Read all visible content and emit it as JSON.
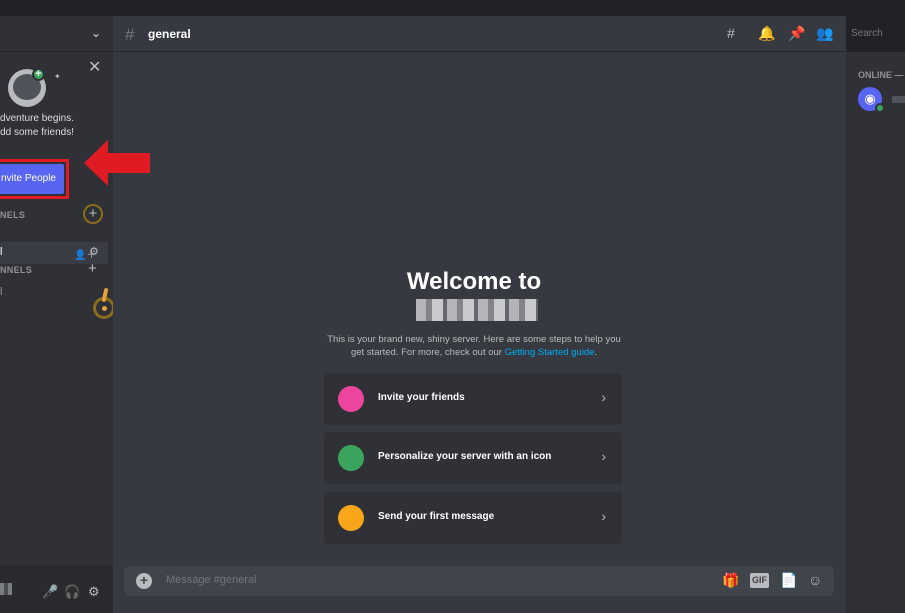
{
  "sidebar": {
    "popup": {
      "close": "✕",
      "line1": "dventure begins.",
      "line2": "dd some friends!",
      "invite_label": "nvite People"
    },
    "text_cat": "NELS",
    "voice_cat": "NNELS",
    "channel_label": "l",
    "voice_label": "l"
  },
  "header": {
    "channel_name": "general",
    "search_placeholder": "Search"
  },
  "welcome": {
    "title": "Welcome to",
    "desc_text": "This is your brand new, shiny server. Here are some steps to help you get started. For more, check out our",
    "link": "Getting Started guide",
    "desc_end": "."
  },
  "actions": [
    {
      "label": "Invite your friends",
      "color": "#eb459e"
    },
    {
      "label": "Personalize your server with an icon",
      "color": "#3ba55d"
    },
    {
      "label": "Send your first message",
      "color": "#faa61a"
    }
  ],
  "composer": {
    "placeholder": "Message #general",
    "gif": "GIF"
  },
  "members": {
    "online_heading": "ONLINE —"
  },
  "colors": {
    "accent": "#5865f2",
    "arrow": "#e01b24"
  }
}
